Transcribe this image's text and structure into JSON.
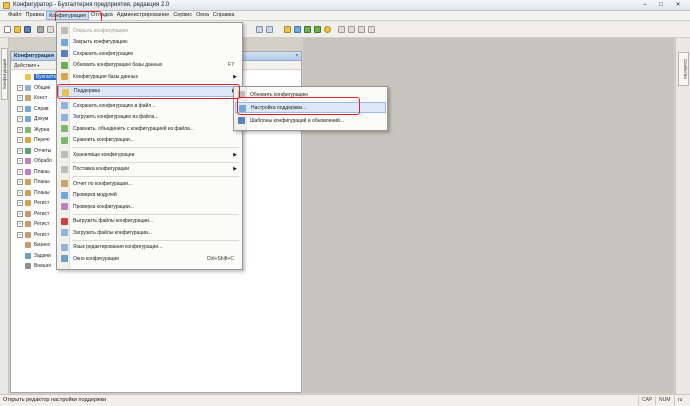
{
  "window": {
    "title": "Конфигуратор - Бухгалтерия предприятия, редакция 2.0"
  },
  "menubar": [
    "Файл",
    "Правка",
    "Конфигурация",
    "Отладка",
    "Администрирование",
    "Сервис",
    "Окна",
    "Справка"
  ],
  "left_tab": "Конфигурация",
  "right_tab": "Свойства",
  "panel": {
    "title": "Конфигурация",
    "actions": "Действия",
    "tree": [
      {
        "label": "Бухгалтерия",
        "selected": true,
        "expander": "none"
      },
      {
        "label": "Общие",
        "expander": "plus"
      },
      {
        "label": "Конст",
        "expander": "plus"
      },
      {
        "label": "Справ",
        "expander": "plus"
      },
      {
        "label": "Докум",
        "expander": "plus"
      },
      {
        "label": "Журна",
        "expander": "plus"
      },
      {
        "label": "Перечі",
        "expander": "plus"
      },
      {
        "label": "Отчеты",
        "expander": "plus"
      },
      {
        "label": "Обрабо",
        "expander": "plus"
      },
      {
        "label": "Планы",
        "expander": "plus"
      },
      {
        "label": "Планы",
        "expander": "plus"
      },
      {
        "label": "Планы",
        "expander": "plus"
      },
      {
        "label": "Регист",
        "expander": "plus"
      },
      {
        "label": "Регист",
        "expander": "plus"
      },
      {
        "label": "Регист",
        "expander": "plus"
      },
      {
        "label": "Регист",
        "expander": "plus"
      },
      {
        "label": "Бизнес",
        "expander": "none"
      },
      {
        "label": "Задачи",
        "expander": "none"
      },
      {
        "label": "Внешні",
        "expander": "none"
      }
    ]
  },
  "config_menu": [
    {
      "label": "Открыть конфигурацию",
      "disabled": true
    },
    {
      "label": "Закрыть конфигурацию"
    },
    {
      "label": "Сохранить конфигурацию"
    },
    {
      "label": "Обновить конфигурацию базы данных",
      "shortcut": "F7"
    },
    {
      "label": "Конфигурация базы данных",
      "submenu": true
    },
    {
      "sep": true
    },
    {
      "label": "Поддержка",
      "submenu": true,
      "highlighted": true
    },
    {
      "sep": true
    },
    {
      "label": "Сохранить конфигурацию в файл..."
    },
    {
      "label": "Загрузить конфигурацию из файла..."
    },
    {
      "label": "Сравнить, объединить с конфигурацией из файла..."
    },
    {
      "label": "Сравнить конфигурации..."
    },
    {
      "sep": true
    },
    {
      "label": "Хранилище конфигурации",
      "submenu": true
    },
    {
      "sep": true
    },
    {
      "label": "Поставка конфигурации",
      "submenu": true
    },
    {
      "sep": true
    },
    {
      "label": "Отчет по конфигурации..."
    },
    {
      "label": "Проверка модулей"
    },
    {
      "label": "Проверка конфигурации..."
    },
    {
      "sep": true
    },
    {
      "label": "Выгрузить файлы конфигурации..."
    },
    {
      "label": "Загрузить файлы конфигурации..."
    },
    {
      "sep": true
    },
    {
      "label": "Язык редактирования конфигурации..."
    },
    {
      "label": "Окно конфигурации",
      "shortcut": "Ctrl+Shift+C"
    }
  ],
  "support_menu": [
    {
      "label": "Обновить конфигурацию"
    },
    {
      "label": "Настройка поддержки...",
      "highlighted": true
    },
    {
      "label": "Шаблоны конфигураций и обновлений..."
    }
  ],
  "status": {
    "text": "Открыть редактор настройки поддержки",
    "indicators": [
      "CAP",
      "NUM",
      "ru"
    ]
  },
  "colors": {
    "highlight_border": "#e1222b",
    "selection": "#3169c6",
    "work_area": "#c7c4bd"
  }
}
